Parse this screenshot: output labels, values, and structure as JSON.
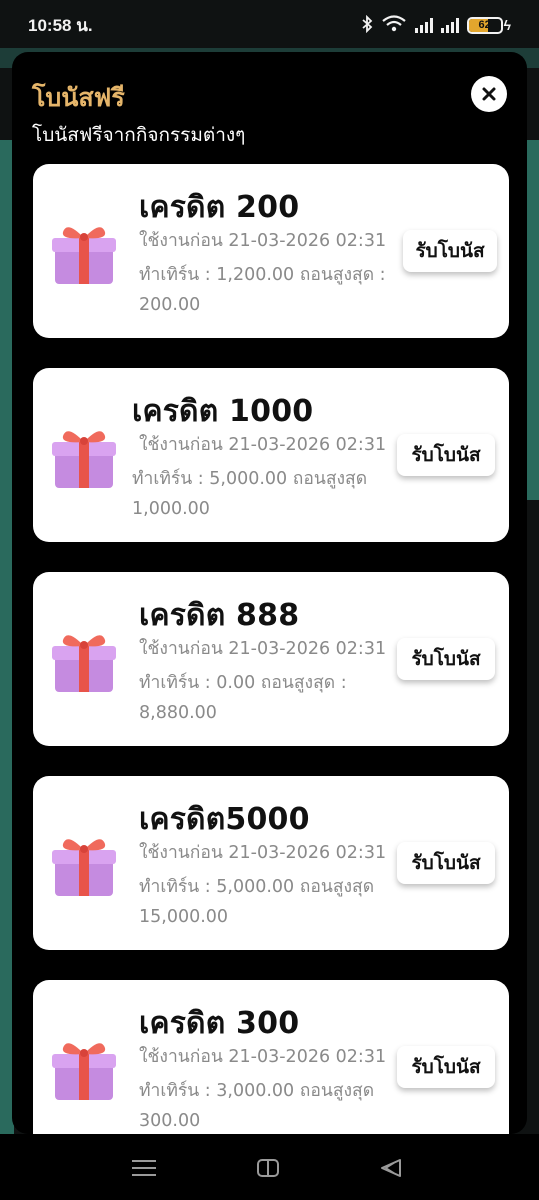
{
  "status_bar": {
    "time": "10:58 น.",
    "battery_percent": 62,
    "battery_label": "62"
  },
  "modal": {
    "title": "โบนัสฟรี",
    "subtitle": "โบนัสฟรีจากกิจกรรมต่างๆ",
    "close_icon": "close-icon"
  },
  "bonuses": [
    {
      "title": "เครดิต 200",
      "expiry": "ใช้งานก่อน 21-03-2026 02:31",
      "turnover": "ทำเทิร์น : 1,200.00  ถอนสูงสุด :",
      "max_withdraw": "200.00",
      "button": "รับโบนัส",
      "icon": "gift-icon"
    },
    {
      "title": "เครดิต 1000",
      "expiry": "ใช้งานก่อน 21-03-2026 02:31",
      "turnover": "ทำเทิร์น : 5,000.00  ถอนสูงสุด",
      "max_withdraw": "1,000.00",
      "button": "รับโบนัส",
      "icon": "gift-icon"
    },
    {
      "title": "เครดิต 888",
      "expiry": "ใช้งานก่อน 21-03-2026 02:31",
      "turnover": "ทำเทิร์น : 0.00  ถอนสูงสุด :",
      "max_withdraw": "8,880.00",
      "button": "รับโบนัส",
      "icon": "gift-icon"
    },
    {
      "title": "เครดิต5000",
      "expiry": "ใช้งานก่อน 21-03-2026 02:31",
      "turnover": "ทำเทิร์น : 5,000.00  ถอนสูงสุด",
      "max_withdraw": "15,000.00",
      "button": "รับโบนัส",
      "icon": "gift-icon"
    },
    {
      "title": "เครดิต 300",
      "expiry": "ใช้งานก่อน 21-03-2026 02:31",
      "turnover": "ทำเทิร์น : 3,000.00  ถอนสูงสุด",
      "max_withdraw": "300.00",
      "button": "รับโบนัส",
      "icon": "gift-icon"
    }
  ],
  "nav": {
    "recents_icon": "menu-lines-icon",
    "home_icon": "home-rect-icon",
    "back_icon": "back-triangle-icon"
  },
  "colors": {
    "title_gold": "#e5b56a",
    "modal_bg": "#000000",
    "card_bg": "#ffffff",
    "backdrop_teal": "#2a6a5d"
  }
}
